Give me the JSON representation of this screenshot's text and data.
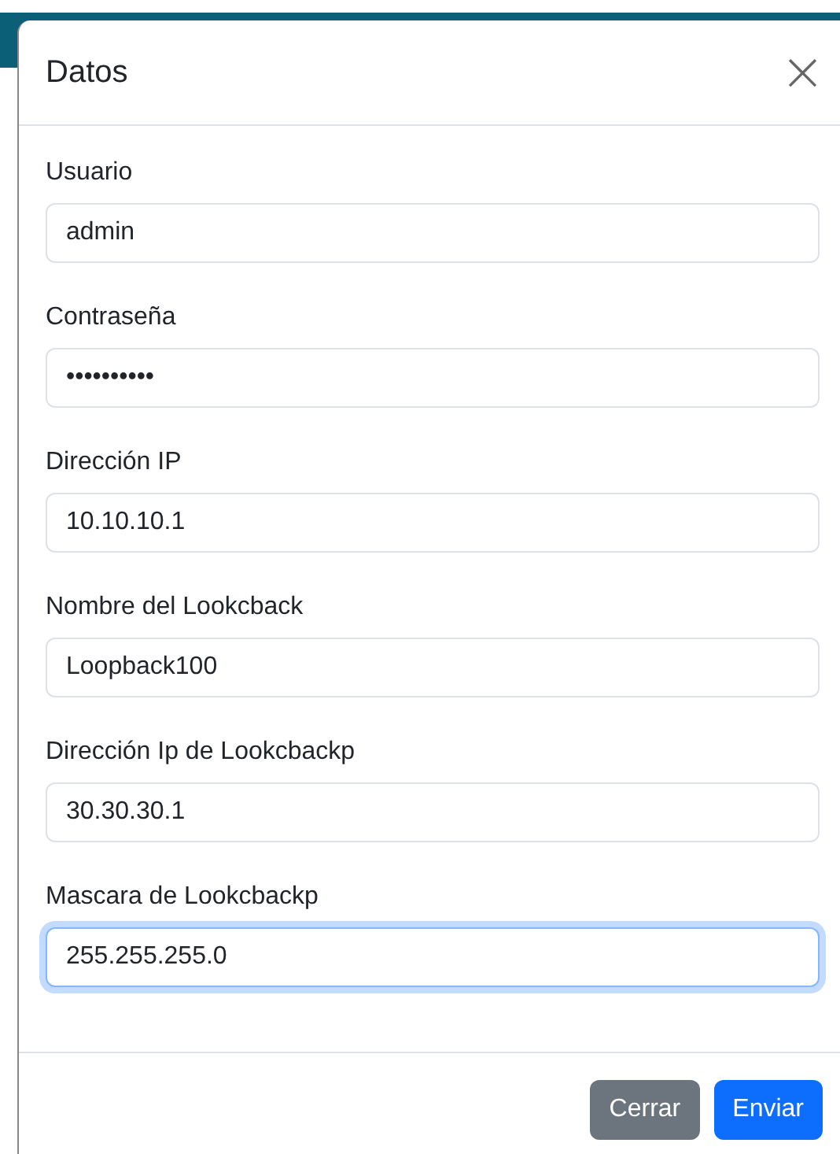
{
  "dialog": {
    "title": "Datos",
    "close": "×"
  },
  "fields": [
    {
      "label": "Usuario",
      "value": "admin",
      "focused": false
    },
    {
      "label": "Contraseña",
      "value": "••••••••••",
      "focused": false
    },
    {
      "label": "Dirección IP",
      "value": "10.10.10.1",
      "focused": false
    },
    {
      "label": "Nombre del Lookcback",
      "value": "Loopback100",
      "focused": false
    },
    {
      "label": "Dirección Ip de Lookcbackp",
      "value": "30.30.30.1",
      "focused": false
    },
    {
      "label": "Mascara de Lookcbackp",
      "value": "255.255.255.0",
      "focused": true
    }
  ],
  "buttons": [
    {
      "label": "Cerrar",
      "kind": "secondary"
    },
    {
      "label": "Enviar",
      "kind": "primary"
    }
  ]
}
